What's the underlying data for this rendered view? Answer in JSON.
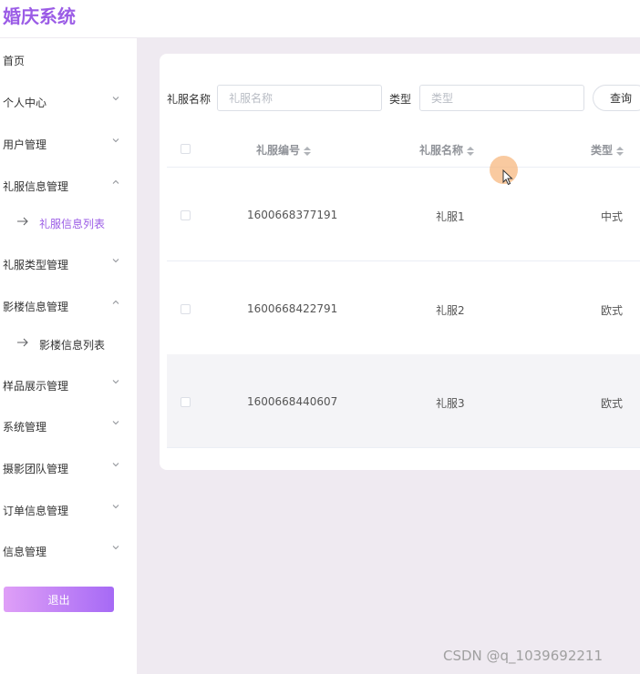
{
  "app": {
    "title": "婚庆系统"
  },
  "sidebar": {
    "items": [
      {
        "label": "首页"
      },
      {
        "label": "个人中心"
      },
      {
        "label": "用户管理"
      },
      {
        "label": "礼服信息管理"
      },
      {
        "label": "礼服信息列表"
      },
      {
        "label": "礼服类型管理"
      },
      {
        "label": "影楼信息管理"
      },
      {
        "label": "影楼信息列表"
      },
      {
        "label": "样品展示管理"
      },
      {
        "label": "系统管理"
      },
      {
        "label": "摄影团队管理"
      },
      {
        "label": "订单信息管理"
      },
      {
        "label": "信息管理"
      }
    ],
    "logout_label": "退出"
  },
  "search": {
    "name_label": "礼服名称",
    "name_placeholder": "礼服名称",
    "name_value": "",
    "type_label": "类型",
    "type_placeholder": "类型",
    "type_value": "",
    "query_label": "查询"
  },
  "table": {
    "headers": [
      "礼服编号",
      "礼服名称",
      "类型"
    ],
    "rows": [
      {
        "id": "1600668377191",
        "name": "礼服1",
        "type": "中式"
      },
      {
        "id": "1600668422791",
        "name": "礼服2",
        "type": "欧式"
      },
      {
        "id": "1600668440607",
        "name": "礼服3",
        "type": "欧式"
      }
    ]
  },
  "watermark": "CSDN @q_1039692211",
  "colors": {
    "accent": "#9b5ce6",
    "main_bg": "#efeaf1",
    "hover_row": "#f4f4f7"
  }
}
